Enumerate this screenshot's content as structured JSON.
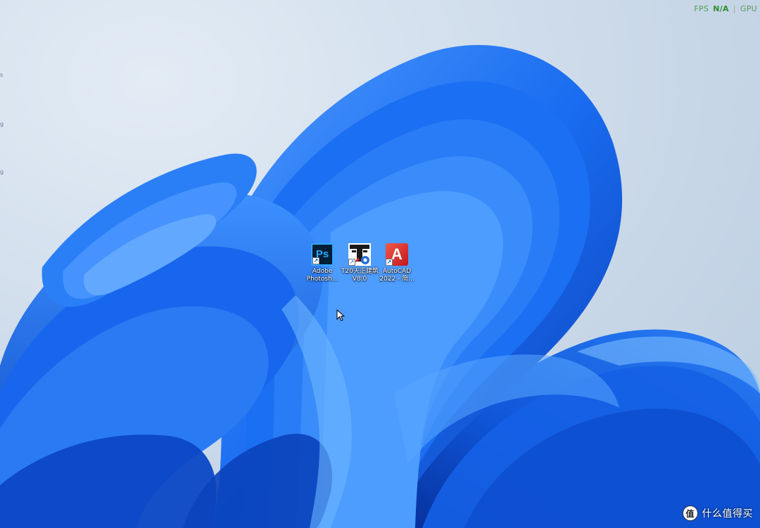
{
  "overlay": {
    "fps_label": "FPS",
    "fps_value": "N/A",
    "separator": "|",
    "gpu_label": "GPU"
  },
  "desktop_icons": [
    {
      "name": "photoshop",
      "label_line1": "Adobe",
      "label_line2": "Photosh...",
      "glyph": "Ps"
    },
    {
      "name": "t20",
      "label_line1": "T20天正建筑",
      "label_line2": "V8.0",
      "glyph": "T"
    },
    {
      "name": "autocad",
      "label_line1": "AutoCAD",
      "label_line2": "2022 - 简...",
      "glyph": "A"
    }
  ],
  "watermark": {
    "badge": "值",
    "text": "什么值得买"
  },
  "colors": {
    "wallpaper_blue": "#1a6cf0",
    "wallpaper_deep": "#0a3fb8",
    "wallpaper_light": "#5aa8ff",
    "background": "#cfdceb",
    "overlay_green": "#4aa04a"
  }
}
